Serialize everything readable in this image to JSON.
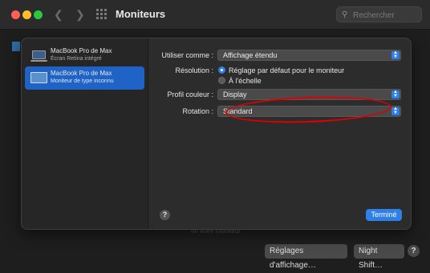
{
  "window": {
    "title": "Moniteurs",
    "search_placeholder": "Rechercher"
  },
  "background": {
    "hint_text": "on voire moniteur",
    "display_settings_button": "Réglages d'affichage…",
    "night_shift_button": "Night Shift…",
    "help": "?"
  },
  "sidebar": {
    "items": [
      {
        "name": "MacBook Pro de Max",
        "subtitle": "Écran Retina intégré",
        "selected": false
      },
      {
        "name": "MacBook Pro de Max",
        "subtitle": "Moniteur de type inconnu",
        "selected": true
      }
    ]
  },
  "settings": {
    "use_as_label": "Utiliser comme :",
    "use_as_value": "Affichage étendu",
    "resolution_label": "Résolution :",
    "resolution_options": [
      {
        "label": "Réglage par défaut pour le moniteur",
        "selected": true
      },
      {
        "label": "À l'échelle",
        "selected": false
      }
    ],
    "color_profile_label": "Profil couleur :",
    "color_profile_value": "Display",
    "rotation_label": "Rotation :",
    "rotation_value": "Standard"
  },
  "footer": {
    "help": "?",
    "done_label": "Terminé"
  },
  "colors": {
    "accent": "#2f7fe8",
    "selection": "#1f63c6",
    "annotation": "#e00000"
  },
  "icons": [
    "search-icon",
    "display-icon",
    "chevron-updown-icon",
    "help-icon"
  ]
}
